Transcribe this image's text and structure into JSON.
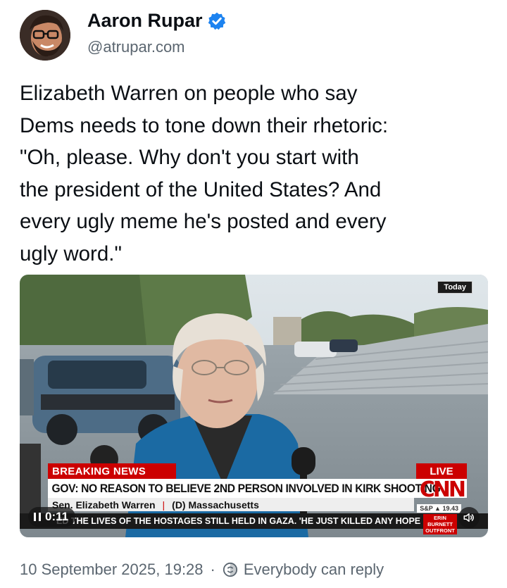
{
  "author": {
    "display_name": "Aaron Rupar",
    "handle": "@atrupar.com",
    "verified_icon": "verified-badge-icon",
    "accent": "#1d83f0"
  },
  "post": {
    "text": "Elizabeth Warren on people who say\nDems needs to tone down their rhetoric:\n\"Oh, please. Why don't you start with\nthe president of the United States? And\nevery ugly meme he's posted and every\nugly word.\""
  },
  "video": {
    "today_badge": "Today",
    "breaking_label": "BREAKING NEWS",
    "live_label": "LIVE",
    "headline": "GOV: NO REASON TO BELIEVE 2ND PERSON INVOLVED IN KIRK SHOOTING",
    "network": "CNN",
    "speaker": "Sen. Elizabeth Warren",
    "speaker_affiliation": "(D) Massachusetts",
    "index": "S&P ▲ 19.43",
    "ticker": "ED THE LIVES OF THE HOSTAGES STILL HELD IN GAZA. 'HE JUST KILLED ANY HOPE FO",
    "show_name": "ERIN BURNETT OUTFRONT",
    "elapsed": "0:11",
    "brand_red": "#cc0000"
  },
  "footer": {
    "timestamp": "10 September 2025, 19:28",
    "separator": "·",
    "reply_setting": "Everybody can reply"
  }
}
